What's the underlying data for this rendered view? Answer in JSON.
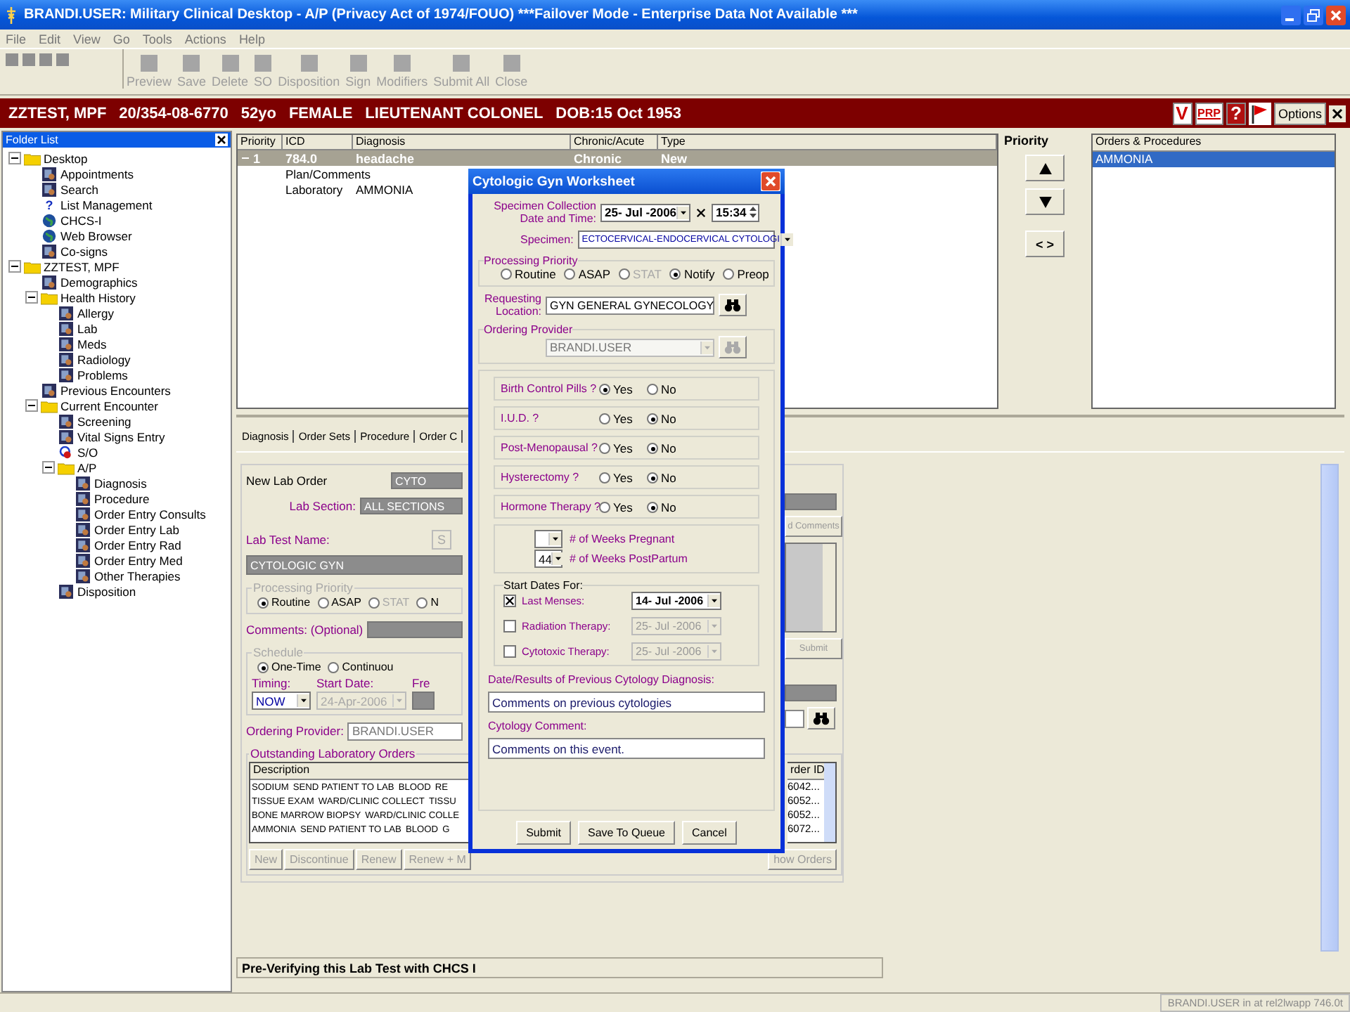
{
  "window": {
    "title": "BRANDI.USER: Military Clinical Desktop - A/P (Privacy Act of 1974/FOUO) ***Failover Mode - Enterprise Data Not Available ***"
  },
  "menu": [
    "File",
    "Edit",
    "View",
    "Go",
    "Tools",
    "Actions",
    "Help"
  ],
  "toolbar": [
    {
      "label": "Preview",
      "disabled": true
    },
    {
      "label": "Save",
      "disabled": true
    },
    {
      "label": "Delete",
      "disabled": true
    },
    {
      "label": "SO",
      "disabled": true
    },
    {
      "label": "Disposition",
      "disabled": true
    },
    {
      "label": "Sign",
      "disabled": true
    },
    {
      "label": "Modifiers",
      "disabled": true
    },
    {
      "label": "Submit All",
      "disabled": true
    },
    {
      "label": "Close",
      "disabled": true
    }
  ],
  "patient": {
    "fields": [
      "ZZTEST, MPF",
      "20/354-08-6770",
      "52yo",
      "FEMALE",
      "LIEUTENANT COLONEL",
      "DOB:15 Oct 1953"
    ],
    "badges": [
      "V",
      "PRP",
      "?"
    ],
    "options": "Options"
  },
  "folder_list": {
    "title": "Folder List",
    "items": [
      {
        "label": "Desktop",
        "kind": "folder",
        "expanded": true,
        "children": [
          {
            "label": "Appointments",
            "kind": "app"
          },
          {
            "label": "Search",
            "kind": "app"
          },
          {
            "label": "List Management",
            "kind": "glyph",
            "glyph": "?"
          },
          {
            "label": "CHCS-I",
            "kind": "globe"
          },
          {
            "label": "Web Browser",
            "kind": "globe"
          },
          {
            "label": "Co-signs",
            "kind": "app"
          }
        ]
      },
      {
        "label": "ZZTEST, MPF",
        "kind": "folder",
        "expanded": true,
        "children": [
          {
            "label": "Demographics",
            "kind": "app"
          },
          {
            "label": "Health History",
            "kind": "folder",
            "expanded": true,
            "children": [
              {
                "label": "Allergy",
                "kind": "app"
              },
              {
                "label": "Lab",
                "kind": "app"
              },
              {
                "label": "Meds",
                "kind": "app"
              },
              {
                "label": "Radiology",
                "kind": "app"
              },
              {
                "label": "Problems",
                "kind": "app"
              }
            ]
          },
          {
            "label": "Previous Encounters",
            "kind": "app"
          },
          {
            "label": "Current Encounter",
            "kind": "folder",
            "expanded": true,
            "children": [
              {
                "label": "Screening",
                "kind": "app"
              },
              {
                "label": "Vital Signs Entry",
                "kind": "app"
              },
              {
                "label": "S/O",
                "kind": "ring"
              },
              {
                "label": "A/P",
                "kind": "folder",
                "expanded": true,
                "children": [
                  {
                    "label": "Diagnosis",
                    "kind": "app"
                  },
                  {
                    "label": "Procedure",
                    "kind": "app"
                  },
                  {
                    "label": "Order Entry Consults",
                    "kind": "app"
                  },
                  {
                    "label": "Order Entry Lab",
                    "kind": "app"
                  },
                  {
                    "label": "Order Entry Rad",
                    "kind": "app"
                  },
                  {
                    "label": "Order Entry Med",
                    "kind": "app"
                  },
                  {
                    "label": "Other Therapies",
                    "kind": "app"
                  }
                ]
              },
              {
                "label": "Disposition",
                "kind": "app"
              }
            ]
          }
        ]
      }
    ]
  },
  "problems": {
    "columns": [
      "Priority",
      "ICD",
      "Diagnosis",
      "Chronic/Acute",
      "Type"
    ],
    "rows": [
      {
        "expanded": true,
        "priority": "1",
        "icd": "784.0",
        "diagnosis": "headache",
        "chronic_acute": "Chronic",
        "type": "New",
        "selected": true
      }
    ],
    "details": [
      {
        "label": "Plan/Comments"
      },
      {
        "label": "Laboratory",
        "value": "AMMONIA"
      }
    ]
  },
  "priority": {
    "title": "Priority",
    "swap": "< >"
  },
  "orders": {
    "title": "Orders & Procedures",
    "items": [
      {
        "label": "AMMONIA",
        "selected": true
      }
    ]
  },
  "tabs": [
    "Diagnosis",
    "Order Sets",
    "Procedure",
    "Order C"
  ],
  "lab_order": {
    "title": "New Lab Order",
    "order_value": "CYTO",
    "section_label": "Lab Section:",
    "section_value": "ALL SECTIONS",
    "test_label": "Lab Test Name:",
    "test_button": "S",
    "test_value": "CYTOLOGIC GYN",
    "priority_group": "Processing Priority",
    "priorities": [
      {
        "label": "Routine",
        "selected": true,
        "disabled": false
      },
      {
        "label": "ASAP",
        "selected": false,
        "disabled": false
      },
      {
        "label": "STAT",
        "selected": false,
        "disabled": true
      },
      {
        "label": "N",
        "selected": false,
        "disabled": false
      }
    ],
    "comments_label": "Comments: (Optional)",
    "schedule_group": "Schedule",
    "schedule": [
      {
        "label": "One-Time",
        "selected": true
      },
      {
        "label": "Continuou",
        "selected": false
      }
    ],
    "timing_label": "Timing:",
    "timing": "NOW",
    "start_label": "Start Date:",
    "start_date": "24-Apr-2006",
    "freq_label": "Fre",
    "provider_label": "Ordering Provider:",
    "provider": "BRANDI.USER",
    "outstanding_group": "Outstanding Laboratory Orders",
    "outstanding_header": "Description",
    "outstanding": [
      [
        "SODIUM",
        "SEND PATIENT TO LAB",
        "BLOOD",
        "RE"
      ],
      [
        "TISSUE EXAM",
        "WARD/CLINIC COLLECT",
        "TISSU"
      ],
      [
        "BONE MARROW BIOPSY",
        "WARD/CLINIC COLLE"
      ],
      [
        "AMMONIA",
        "SEND PATIENT TO LAB",
        "BLOOD",
        "G"
      ]
    ],
    "buttons": [
      "New",
      "Discontinue",
      "Renew",
      "Renew + M"
    ],
    "right": {
      "comments_button": "d Comments",
      "submit": "Submit",
      "id_header": "rder ID",
      "ids": [
        "6042...",
        "6052...",
        "6052...",
        "6072..."
      ],
      "show_button": "how Orders"
    }
  },
  "dialog": {
    "title": "Cytologic Gyn Worksheet",
    "collection_label": "Specimen Collection Date and Time:",
    "date": "25- Jul -2006",
    "time_checked": true,
    "time": "15:34",
    "specimen_label": "Specimen:",
    "specimen": "ECTOCERVICAL-ENDOCERVICAL CYTOLOGI",
    "priority_group": "Processing Priority",
    "priorities": [
      {
        "label": "Routine",
        "selected": false,
        "disabled": false
      },
      {
        "label": "ASAP",
        "selected": false,
        "disabled": false
      },
      {
        "label": "STAT",
        "selected": false,
        "disabled": true
      },
      {
        "label": "Notify",
        "selected": true,
        "disabled": false
      },
      {
        "label": "Preop",
        "selected": false,
        "disabled": false
      }
    ],
    "location_label": "Requesting Location:",
    "location": "GYN GENERAL GYNECOLOGY",
    "provider_group": "Ordering Provider",
    "provider": "BRANDI.USER",
    "questions": [
      {
        "label": "Birth Control Pills ?",
        "options": [
          {
            "label": "Yes",
            "selected": true
          },
          {
            "label": "No",
            "selected": false
          }
        ]
      },
      {
        "label": "I.U.D. ?",
        "options": [
          {
            "label": "Yes",
            "selected": false
          },
          {
            "label": "No",
            "selected": true
          }
        ]
      },
      {
        "label": "Post-Menopausal ?",
        "options": [
          {
            "label": "Yes",
            "selected": false
          },
          {
            "label": "No",
            "selected": true
          }
        ]
      },
      {
        "label": "Hysterectomy ?",
        "options": [
          {
            "label": "Yes",
            "selected": false
          },
          {
            "label": "No",
            "selected": true
          }
        ]
      },
      {
        "label": "Hormone Therapy ?",
        "options": [
          {
            "label": "Yes",
            "selected": false
          },
          {
            "label": "No",
            "selected": true
          }
        ]
      }
    ],
    "weeks": [
      {
        "label": "# of Weeks Pregnant"
      },
      {
        "value": "44",
        "label": "# of Weeks PostPartum"
      }
    ],
    "start_title": "Start Dates For:",
    "start_dates": [
      {
        "label": "Last Menses:",
        "checked": true,
        "date": "14- Jul -2006"
      },
      {
        "label": "Radiation Therapy:",
        "checked": false,
        "date": "25- Jul -2006"
      },
      {
        "label": "Cytotoxic Therapy:",
        "checked": false,
        "date": "25- Jul -2006"
      }
    ],
    "previous_label": "Date/Results of Previous Cytology Diagnosis:",
    "previous_value": "Comments on previous cytologies",
    "comment_label": "Cytology Comment:",
    "comment_value": "Comments on this event.",
    "buttons": [
      "Submit",
      "Save To Queue",
      "Cancel"
    ]
  },
  "status_message": "Pre-Verifying this Lab Test with CHCS I",
  "status_bar": "BRANDI.USER in at rel2lwapp 746.0t"
}
